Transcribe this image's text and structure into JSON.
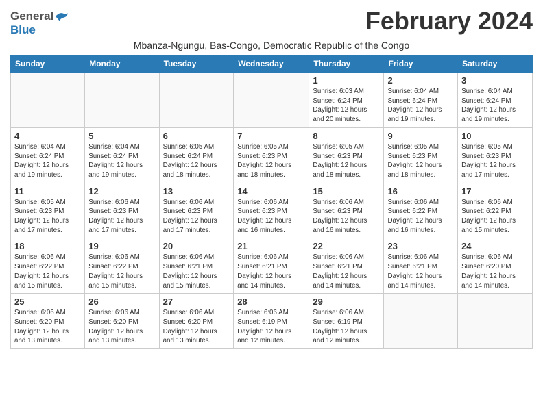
{
  "header": {
    "logo_general": "General",
    "logo_blue": "Blue",
    "month_title": "February 2024",
    "subtitle": "Mbanza-Ngungu, Bas-Congo, Democratic Republic of the Congo"
  },
  "days_of_week": [
    "Sunday",
    "Monday",
    "Tuesday",
    "Wednesday",
    "Thursday",
    "Friday",
    "Saturday"
  ],
  "weeks": [
    [
      {
        "day": "",
        "detail": ""
      },
      {
        "day": "",
        "detail": ""
      },
      {
        "day": "",
        "detail": ""
      },
      {
        "day": "",
        "detail": ""
      },
      {
        "day": "1",
        "detail": "Sunrise: 6:03 AM\nSunset: 6:24 PM\nDaylight: 12 hours\nand 20 minutes."
      },
      {
        "day": "2",
        "detail": "Sunrise: 6:04 AM\nSunset: 6:24 PM\nDaylight: 12 hours\nand 19 minutes."
      },
      {
        "day": "3",
        "detail": "Sunrise: 6:04 AM\nSunset: 6:24 PM\nDaylight: 12 hours\nand 19 minutes."
      }
    ],
    [
      {
        "day": "4",
        "detail": "Sunrise: 6:04 AM\nSunset: 6:24 PM\nDaylight: 12 hours\nand 19 minutes."
      },
      {
        "day": "5",
        "detail": "Sunrise: 6:04 AM\nSunset: 6:24 PM\nDaylight: 12 hours\nand 19 minutes."
      },
      {
        "day": "6",
        "detail": "Sunrise: 6:05 AM\nSunset: 6:24 PM\nDaylight: 12 hours\nand 18 minutes."
      },
      {
        "day": "7",
        "detail": "Sunrise: 6:05 AM\nSunset: 6:23 PM\nDaylight: 12 hours\nand 18 minutes."
      },
      {
        "day": "8",
        "detail": "Sunrise: 6:05 AM\nSunset: 6:23 PM\nDaylight: 12 hours\nand 18 minutes."
      },
      {
        "day": "9",
        "detail": "Sunrise: 6:05 AM\nSunset: 6:23 PM\nDaylight: 12 hours\nand 18 minutes."
      },
      {
        "day": "10",
        "detail": "Sunrise: 6:05 AM\nSunset: 6:23 PM\nDaylight: 12 hours\nand 17 minutes."
      }
    ],
    [
      {
        "day": "11",
        "detail": "Sunrise: 6:05 AM\nSunset: 6:23 PM\nDaylight: 12 hours\nand 17 minutes."
      },
      {
        "day": "12",
        "detail": "Sunrise: 6:06 AM\nSunset: 6:23 PM\nDaylight: 12 hours\nand 17 minutes."
      },
      {
        "day": "13",
        "detail": "Sunrise: 6:06 AM\nSunset: 6:23 PM\nDaylight: 12 hours\nand 17 minutes."
      },
      {
        "day": "14",
        "detail": "Sunrise: 6:06 AM\nSunset: 6:23 PM\nDaylight: 12 hours\nand 16 minutes."
      },
      {
        "day": "15",
        "detail": "Sunrise: 6:06 AM\nSunset: 6:23 PM\nDaylight: 12 hours\nand 16 minutes."
      },
      {
        "day": "16",
        "detail": "Sunrise: 6:06 AM\nSunset: 6:22 PM\nDaylight: 12 hours\nand 16 minutes."
      },
      {
        "day": "17",
        "detail": "Sunrise: 6:06 AM\nSunset: 6:22 PM\nDaylight: 12 hours\nand 15 minutes."
      }
    ],
    [
      {
        "day": "18",
        "detail": "Sunrise: 6:06 AM\nSunset: 6:22 PM\nDaylight: 12 hours\nand 15 minutes."
      },
      {
        "day": "19",
        "detail": "Sunrise: 6:06 AM\nSunset: 6:22 PM\nDaylight: 12 hours\nand 15 minutes."
      },
      {
        "day": "20",
        "detail": "Sunrise: 6:06 AM\nSunset: 6:21 PM\nDaylight: 12 hours\nand 15 minutes."
      },
      {
        "day": "21",
        "detail": "Sunrise: 6:06 AM\nSunset: 6:21 PM\nDaylight: 12 hours\nand 14 minutes."
      },
      {
        "day": "22",
        "detail": "Sunrise: 6:06 AM\nSunset: 6:21 PM\nDaylight: 12 hours\nand 14 minutes."
      },
      {
        "day": "23",
        "detail": "Sunrise: 6:06 AM\nSunset: 6:21 PM\nDaylight: 12 hours\nand 14 minutes."
      },
      {
        "day": "24",
        "detail": "Sunrise: 6:06 AM\nSunset: 6:20 PM\nDaylight: 12 hours\nand 14 minutes."
      }
    ],
    [
      {
        "day": "25",
        "detail": "Sunrise: 6:06 AM\nSunset: 6:20 PM\nDaylight: 12 hours\nand 13 minutes."
      },
      {
        "day": "26",
        "detail": "Sunrise: 6:06 AM\nSunset: 6:20 PM\nDaylight: 12 hours\nand 13 minutes."
      },
      {
        "day": "27",
        "detail": "Sunrise: 6:06 AM\nSunset: 6:20 PM\nDaylight: 12 hours\nand 13 minutes."
      },
      {
        "day": "28",
        "detail": "Sunrise: 6:06 AM\nSunset: 6:19 PM\nDaylight: 12 hours\nand 12 minutes."
      },
      {
        "day": "29",
        "detail": "Sunrise: 6:06 AM\nSunset: 6:19 PM\nDaylight: 12 hours\nand 12 minutes."
      },
      {
        "day": "",
        "detail": ""
      },
      {
        "day": "",
        "detail": ""
      }
    ]
  ]
}
